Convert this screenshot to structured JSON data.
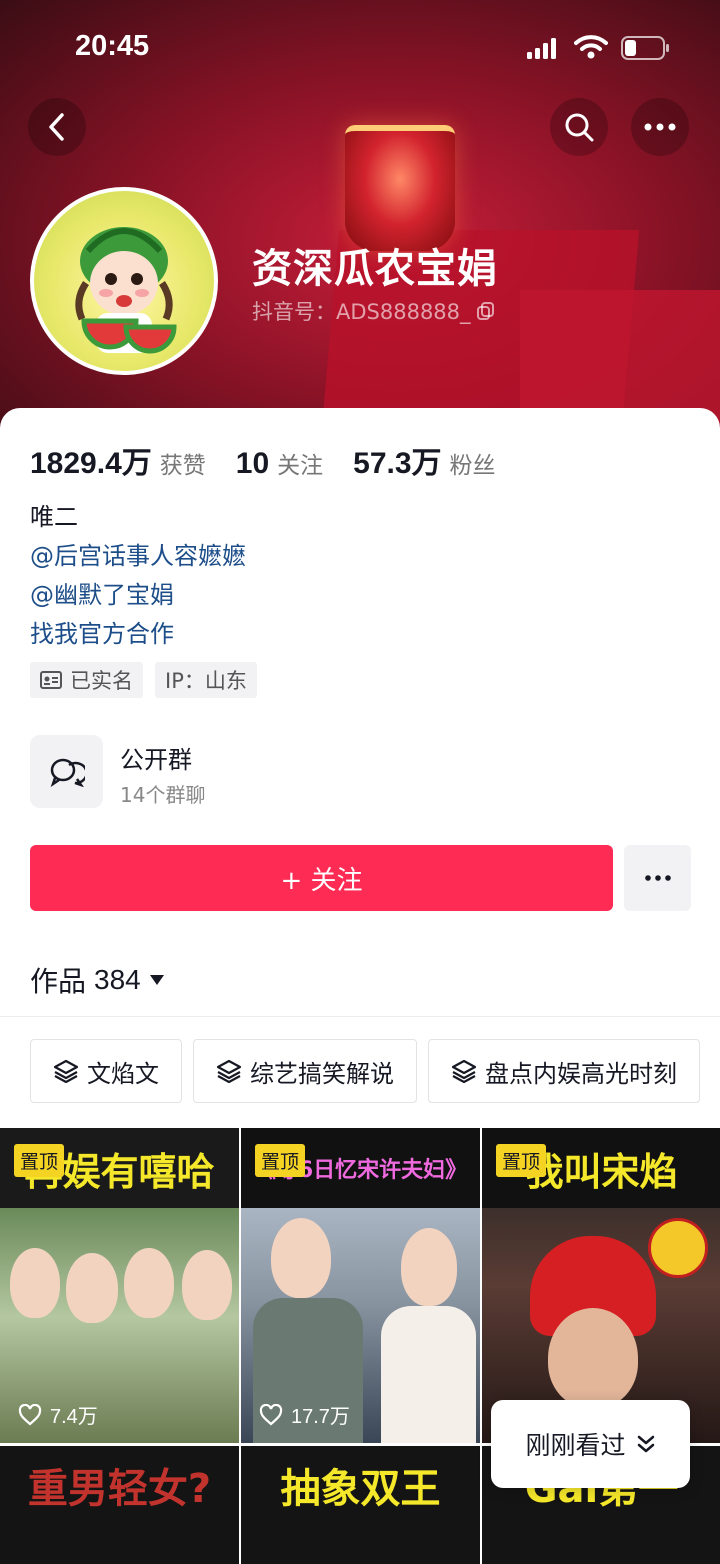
{
  "status_bar": {
    "time": "20:45"
  },
  "profile": {
    "name": "资深瓜农宝娟",
    "douyin_id": "抖音号：ADS888888_"
  },
  "stats": [
    {
      "value": "1829.4万",
      "label": "获赞"
    },
    {
      "value": "10",
      "label": "关注"
    },
    {
      "value": "57.3万",
      "label": "粉丝"
    }
  ],
  "bio": {
    "line1": "唯二",
    "mention1": "@后宫话事人容嬷嬷",
    "mention2": "@幽默了宝娟",
    "link": "找我官方合作"
  },
  "tags": {
    "verified": "已实名",
    "ip": "IP：山东"
  },
  "group": {
    "title": "公开群",
    "subtitle": "14个群聊"
  },
  "actions": {
    "follow": "+ 关注"
  },
  "works": {
    "label": "作品",
    "count": "384"
  },
  "filters": [
    "文焰文",
    "综艺搞笑解说",
    "盘点内娱高光时刻"
  ],
  "videos": [
    {
      "pin": "置顶",
      "title": "再娱有嘻哈",
      "likes": "7.4万"
    },
    {
      "pin": "置顶",
      "title": "《等6日忆宋许夫妇》",
      "likes": "17.7万"
    },
    {
      "pin": "置顶",
      "title": "我叫宋焰"
    }
  ],
  "videos_row2": [
    {
      "title": "重男轻女?"
    },
    {
      "title": "抽象双王"
    },
    {
      "title": "Gai第一"
    }
  ],
  "floating": {
    "recent": "刚刚看过"
  },
  "colors": {
    "accent": "#fe2c55",
    "link": "#1d4e89",
    "pin": "#f5d323"
  }
}
